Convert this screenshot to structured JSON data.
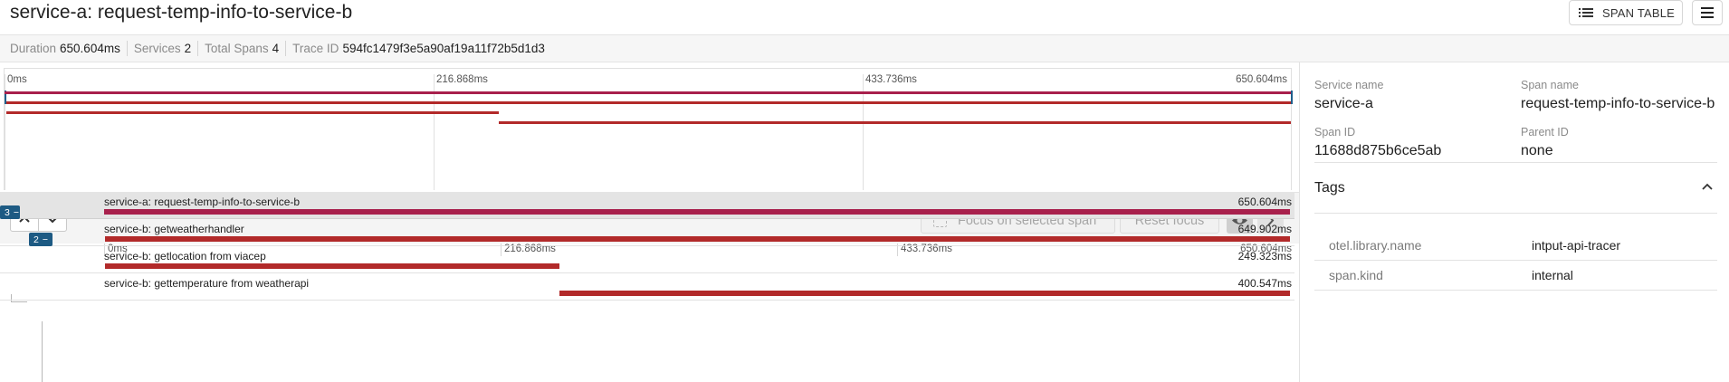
{
  "header": {
    "title": "service-a: request-temp-info-to-service-b",
    "span_table_label": "SPAN TABLE"
  },
  "stats": {
    "duration_label": "Duration",
    "duration_value": "650.604ms",
    "services_label": "Services",
    "services_value": "2",
    "total_spans_label": "Total Spans",
    "total_spans_value": "4",
    "trace_id_label": "Trace ID",
    "trace_id_value": "594fc1479f3e5a90af19a11f72b5d1d3"
  },
  "minimap": {
    "ticks": [
      "0ms",
      "216.868ms",
      "433.736ms",
      "650.604ms"
    ]
  },
  "controls": {
    "focus_label": "Focus on selected span",
    "reset_label": "Reset focus"
  },
  "ruler": {
    "ticks": [
      "0ms",
      "216.868ms",
      "433.736ms",
      "650.604ms"
    ]
  },
  "spans": [
    {
      "name": "service-a: request-temp-info-to-service-b",
      "duration": "650.604ms",
      "start_ms": 0,
      "duration_ms": 650.604,
      "color": "#a8204c",
      "badge": "3"
    },
    {
      "name": "service-b: getweatherhandler",
      "duration": "649.902ms",
      "start_ms": 0.7,
      "duration_ms": 649.902,
      "color": "#b22a2a",
      "badge": "2"
    },
    {
      "name": "service-b: getlocation from viacep",
      "duration": "249.323ms",
      "start_ms": 0.7,
      "duration_ms": 249.323,
      "color": "#b22a2a",
      "badge": ""
    },
    {
      "name": "service-b: gettemperature from weatherapi",
      "duration": "400.547ms",
      "start_ms": 250.057,
      "duration_ms": 400.547,
      "color": "#b22a2a",
      "badge": ""
    }
  ],
  "trace_total_ms": 650.604,
  "details": {
    "service_name_label": "Service name",
    "service_name_value": "service-a",
    "span_name_label": "Span name",
    "span_name_value": "request-temp-info-to-service-b",
    "span_id_label": "Span ID",
    "span_id_value": "11688d875b6ce5ab",
    "parent_id_label": "Parent ID",
    "parent_id_value": "none",
    "tags_title": "Tags",
    "tags": [
      {
        "key": "otel.library.name",
        "value": "intput-api-tracer"
      },
      {
        "key": "span.kind",
        "value": "internal"
      }
    ]
  },
  "icons": {
    "span_table": "list-icon",
    "menu": "hamburger-menu-icon",
    "up": "chevron-up-icon",
    "down": "chevron-down-icon",
    "focus": "focus-frame-icon",
    "eye": "eye-icon",
    "next": "chevron-right-icon",
    "tags_collapse": "chevron-up-icon"
  }
}
